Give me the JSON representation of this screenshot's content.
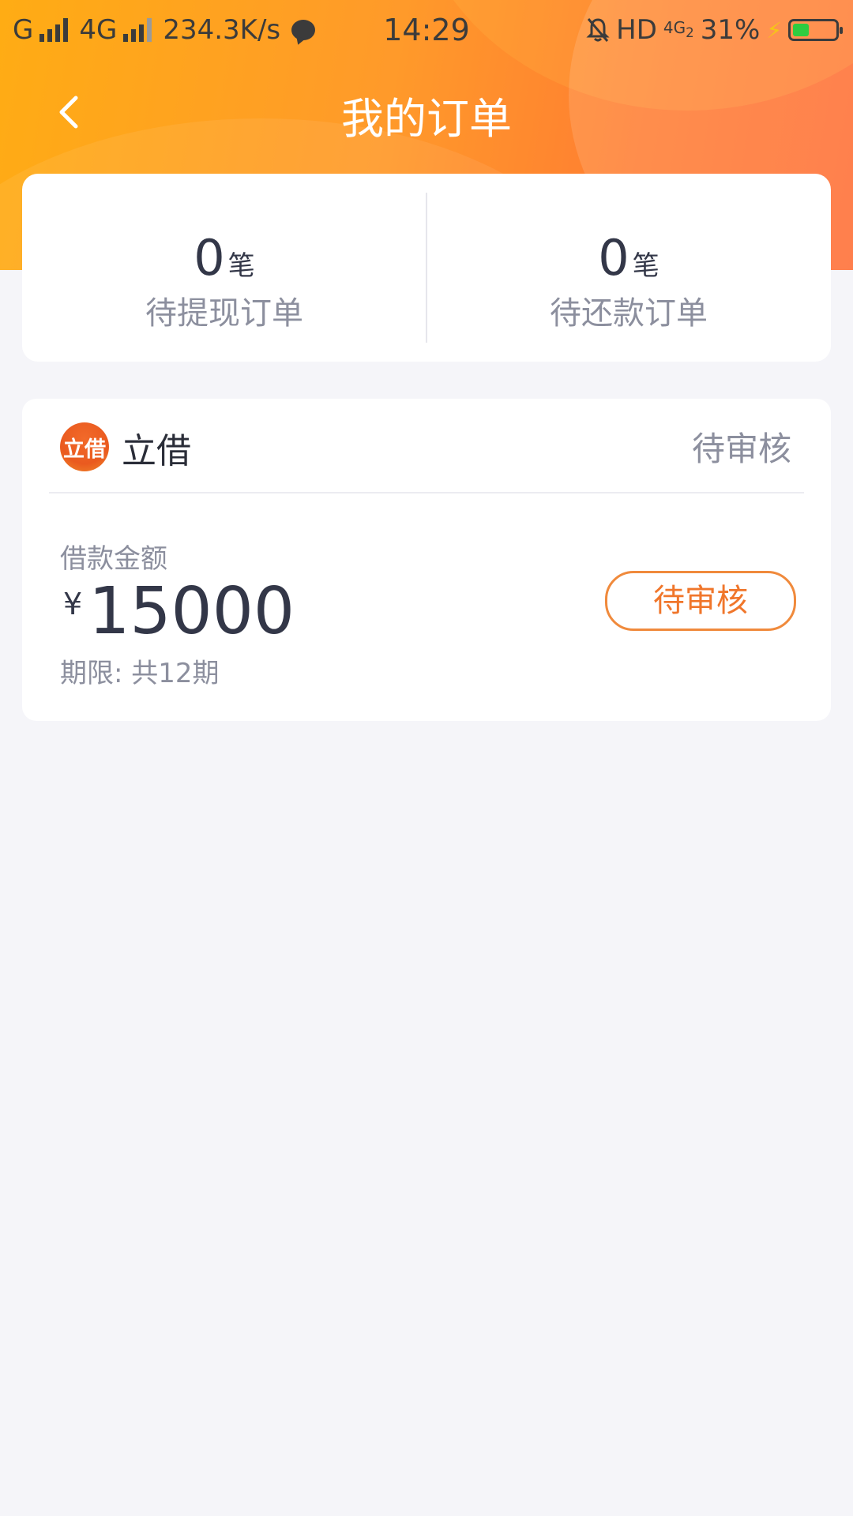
{
  "status_bar": {
    "carrier1": "G",
    "carrier2": "4G",
    "speed": "234.3K/s",
    "time": "14:29",
    "hd": "HD",
    "net": "4G",
    "net_sub": "2",
    "battery": "31%",
    "battery_level": 0.31
  },
  "nav": {
    "title": "我的订单",
    "back_icon": "chevron-left-icon"
  },
  "summary": [
    {
      "count": "0",
      "unit": "笔",
      "label": "待提现订单"
    },
    {
      "count": "0",
      "unit": "笔",
      "label": "待还款订单"
    }
  ],
  "order": {
    "logo_text": "立借",
    "product_name": "立借",
    "status": "待审核",
    "amount_label": "借款金额",
    "currency": "¥",
    "amount": "15000",
    "period": "期限: 共12期",
    "button_label": "待审核"
  },
  "colors": {
    "header_start": "#ffac14",
    "header_end": "#ff6d33",
    "accent": "#f0762b",
    "background": "#f5f5f9"
  }
}
